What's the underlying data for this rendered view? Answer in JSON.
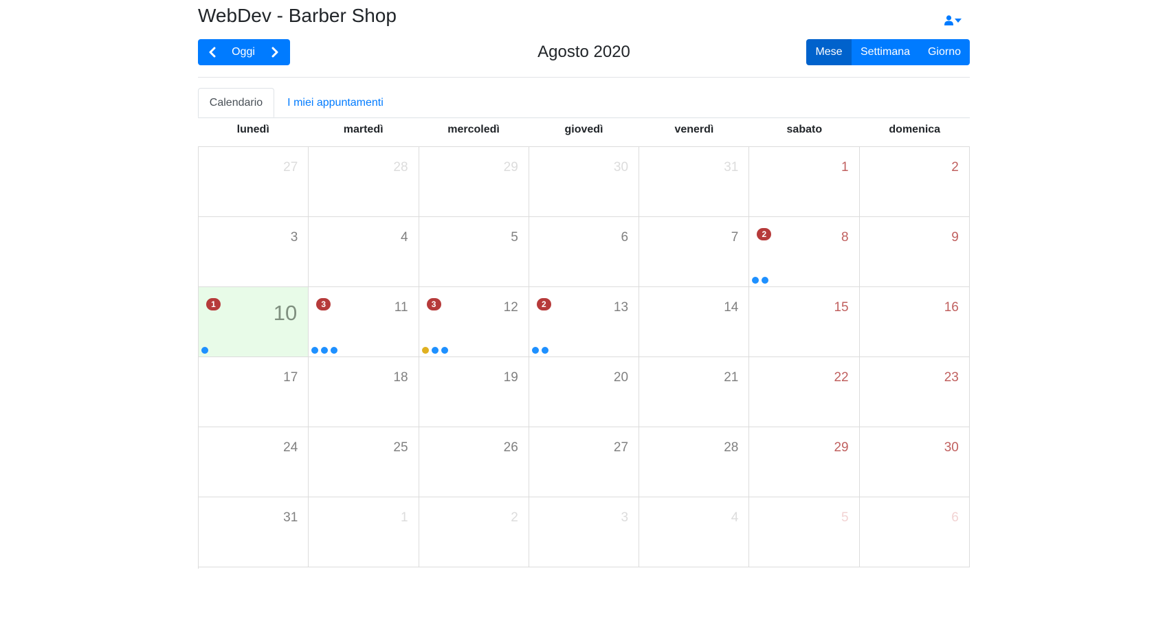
{
  "app": {
    "title": "WebDev - Barber Shop"
  },
  "header": {
    "user_menu_icon": "user-icon",
    "prev_icon": "chevron-left-icon",
    "next_icon": "chevron-right-icon",
    "today_label": "Oggi",
    "month_title": "Agosto 2020",
    "views": [
      {
        "label": "Mese",
        "active": true
      },
      {
        "label": "Settimana",
        "active": false
      },
      {
        "label": "Giorno",
        "active": false
      }
    ]
  },
  "tabs": [
    {
      "label": "Calendario",
      "active": true
    },
    {
      "label": "I miei appuntamenti",
      "active": false
    }
  ],
  "calendar": {
    "weekdays": [
      "lunedì",
      "martedì",
      "mercoledì",
      "giovedì",
      "venerdì",
      "sabato",
      "domenica"
    ],
    "colors": {
      "today_bg": "#e8fbe8",
      "badge": "#b63a3a",
      "dot_blue": "#1e90ff",
      "dot_yellow": "#e0b020",
      "weekend": "#c0605f"
    },
    "weeks": [
      [
        {
          "day": "27",
          "other": true
        },
        {
          "day": "28",
          "other": true
        },
        {
          "day": "29",
          "other": true
        },
        {
          "day": "30",
          "other": true
        },
        {
          "day": "31",
          "other": true
        },
        {
          "day": "1"
        },
        {
          "day": "2"
        }
      ],
      [
        {
          "day": "3"
        },
        {
          "day": "4"
        },
        {
          "day": "5"
        },
        {
          "day": "6"
        },
        {
          "day": "7"
        },
        {
          "day": "8",
          "badge": "2",
          "dots": [
            "blue",
            "blue"
          ]
        },
        {
          "day": "9"
        }
      ],
      [
        {
          "day": "10",
          "today": true,
          "badge": "1",
          "dots": [
            "blue"
          ]
        },
        {
          "day": "11",
          "badge": "3",
          "dots": [
            "blue",
            "blue",
            "blue"
          ]
        },
        {
          "day": "12",
          "badge": "3",
          "dots": [
            "yellow",
            "blue",
            "blue"
          ]
        },
        {
          "day": "13",
          "badge": "2",
          "dots": [
            "blue",
            "blue"
          ]
        },
        {
          "day": "14"
        },
        {
          "day": "15"
        },
        {
          "day": "16"
        }
      ],
      [
        {
          "day": "17"
        },
        {
          "day": "18"
        },
        {
          "day": "19"
        },
        {
          "day": "20"
        },
        {
          "day": "21"
        },
        {
          "day": "22"
        },
        {
          "day": "23"
        }
      ],
      [
        {
          "day": "24"
        },
        {
          "day": "25"
        },
        {
          "day": "26"
        },
        {
          "day": "27"
        },
        {
          "day": "28"
        },
        {
          "day": "29"
        },
        {
          "day": "30"
        }
      ],
      [
        {
          "day": "31"
        },
        {
          "day": "1",
          "other": true
        },
        {
          "day": "2",
          "other": true
        },
        {
          "day": "3",
          "other": true
        },
        {
          "day": "4",
          "other": true
        },
        {
          "day": "5",
          "other": true
        },
        {
          "day": "6",
          "other": true
        }
      ]
    ]
  }
}
